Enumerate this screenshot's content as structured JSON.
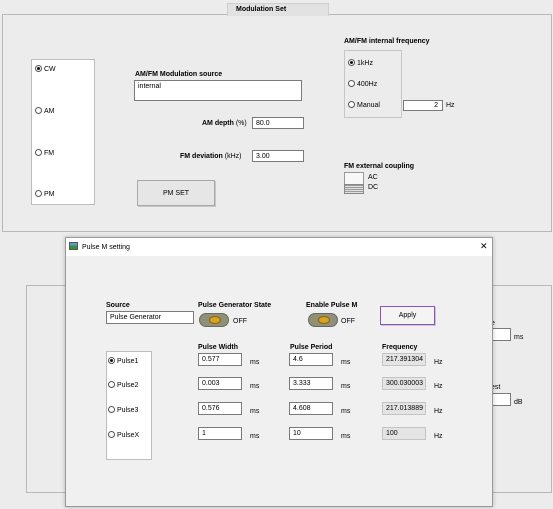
{
  "main": {
    "tab_title": "Modulation Set",
    "modes": [
      "CW",
      "AM",
      "FM",
      "PM"
    ],
    "selected_mode": "CW",
    "mod_source_label": "AM/FM Modulation source",
    "mod_source_value": "internal",
    "am_depth_label": "AM depth",
    "am_depth_unit": "(%)",
    "am_depth_value": "80.0",
    "fm_dev_label": "FM deviation",
    "fm_dev_unit": "(kHz)",
    "fm_dev_value": "3.00",
    "pm_set_button": "PM SET",
    "int_freq_label": "AM/FM internal frequency",
    "int_freq_options": [
      "1kHz",
      "400Hz",
      "Manual"
    ],
    "int_freq_selected": "1kHz",
    "manual_value": "2",
    "manual_unit": "Hz",
    "ext_coupling_label": "FM external coupling",
    "ext_coupling_ac": "AC",
    "ext_coupling_dc": "DC"
  },
  "lower_panel": {
    "partial_label_1": "e",
    "unit_1": "ms",
    "partial_label_2": "est",
    "unit_2": "dB"
  },
  "dialog": {
    "title": "Pulse M setting",
    "close": "✕",
    "source_label": "Source",
    "source_value": "Pulse Generator",
    "gen_state_label": "Pulse Generator State",
    "gen_state_value": "OFF",
    "enable_label": "Enable Pulse M",
    "enable_value": "OFF",
    "apply_button": "Apply",
    "col_width": "Pulse Width",
    "col_period": "Pulse Period",
    "col_freq": "Frequency",
    "unit_ms": "ms",
    "unit_hz": "Hz",
    "selected_pulse": "Pulse1",
    "rows": [
      {
        "name": "Pulse1",
        "width": "0.577",
        "period": "4.6",
        "freq": "217.391304"
      },
      {
        "name": "Pulse2",
        "width": "0.003",
        "period": "3.333",
        "freq": "300.030003"
      },
      {
        "name": "Pulse3",
        "width": "0.576",
        "period": "4.608",
        "freq": "217.013889"
      },
      {
        "name": "PulseX",
        "width": "1",
        "period": "10",
        "freq": "100"
      }
    ]
  }
}
